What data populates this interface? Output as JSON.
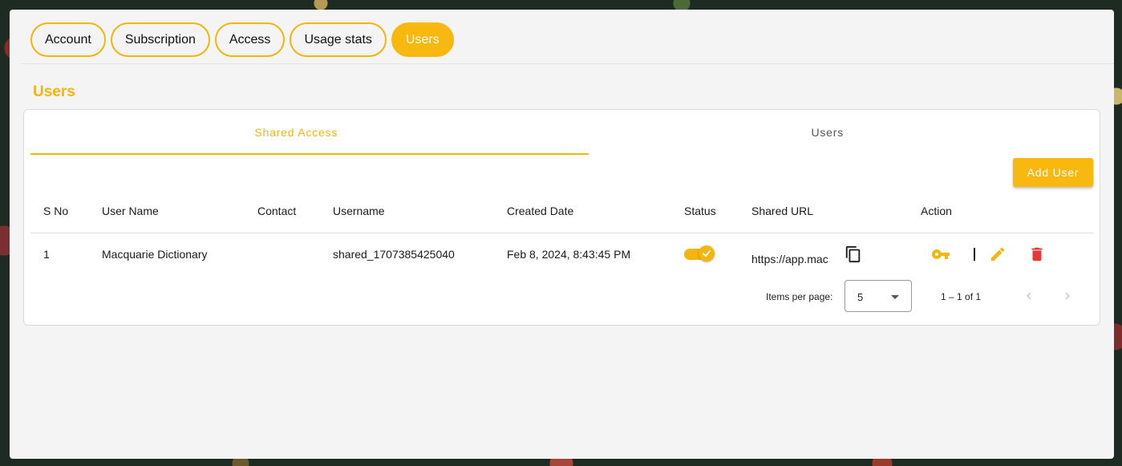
{
  "top_tabs": [
    {
      "label": "Account",
      "active": false
    },
    {
      "label": "Subscription",
      "active": false
    },
    {
      "label": "Access",
      "active": false
    },
    {
      "label": "Usage stats",
      "active": false
    },
    {
      "label": "Users",
      "active": true
    }
  ],
  "section_title": "Users",
  "sub_tabs": [
    {
      "label": "Shared Access",
      "active": true
    },
    {
      "label": "Users",
      "active": false
    }
  ],
  "add_user_label": "Add User",
  "table": {
    "headers": [
      "S No",
      "User Name",
      "Contact",
      "Username",
      "Created Date",
      "Status",
      "Shared URL",
      "Action"
    ],
    "rows": [
      {
        "s_no": "1",
        "user_name": "Macquarie Dictionary",
        "contact": "",
        "username": "shared_1707385425040",
        "created_date": "Feb 8, 2024, 8:43:45 PM",
        "status_on": true,
        "shared_url": "https://app.mac"
      }
    ]
  },
  "paginator": {
    "items_per_page_label": "Items per page:",
    "page_size": "5",
    "range_label": "1 – 1 of 1"
  },
  "colors": {
    "accent": "#f5b50f",
    "delete": "#e53935"
  },
  "icons": {
    "copy": "copy-icon",
    "key": "key-icon",
    "edit": "pencil-icon",
    "delete": "trash-icon",
    "prev": "chevron-left-icon",
    "next": "chevron-right-icon"
  }
}
